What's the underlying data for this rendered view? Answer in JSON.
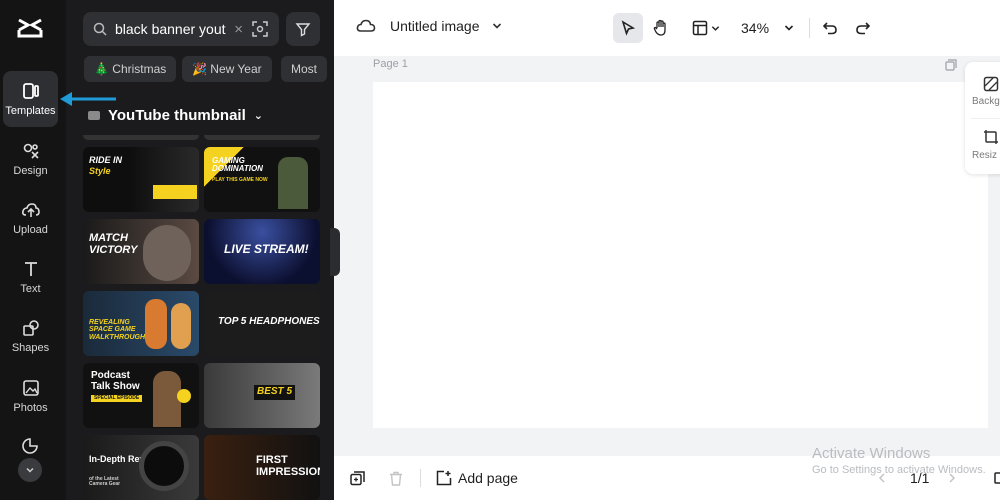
{
  "rail": {
    "items": [
      {
        "label": "Templates",
        "icon": "templates-icon"
      },
      {
        "label": "Design",
        "icon": "design-icon"
      },
      {
        "label": "Upload",
        "icon": "upload-icon"
      },
      {
        "label": "Text",
        "icon": "text-icon"
      },
      {
        "label": "Shapes",
        "icon": "shapes-icon"
      },
      {
        "label": "Photos",
        "icon": "photos-icon"
      }
    ]
  },
  "search": {
    "value": "black banner yout",
    "clear": "×"
  },
  "chips": [
    "🎄 Christmas",
    "🎉 New Year",
    "Most"
  ],
  "category": {
    "label": "YouTube thumbnail",
    "chevron": "⌄"
  },
  "templates": [
    {
      "title": "RIDE IN",
      "subtitle": "Style"
    },
    {
      "title": "GAMING DOMINATION",
      "subtitle": "PLAY THIS GAME NOW"
    },
    {
      "title": "MATCH VICTORY",
      "subtitle": ""
    },
    {
      "title": "LIVE STREAM!",
      "subtitle": ""
    },
    {
      "title": "REVEALING SPACE GAME WALKTHROUGH",
      "subtitle": ""
    },
    {
      "title": "TOP 5 HEADPHONES",
      "subtitle": ""
    },
    {
      "title": "Podcast Talk Show",
      "subtitle": "SPECIAL EPISODE"
    },
    {
      "title": "BEST 5",
      "subtitle": ""
    },
    {
      "title": "In-Depth Review",
      "subtitle": "of the Latest Camera Gear"
    },
    {
      "title": "FIRST IMPRESSION",
      "subtitle": ""
    }
  ],
  "topbar": {
    "title": "Untitled image",
    "zoom": "34%"
  },
  "canvas": {
    "page_label": "Page 1"
  },
  "side": {
    "background": "Backg",
    "resize": "Resiz"
  },
  "bottombar": {
    "add_page": "Add page",
    "pager": "1/1"
  },
  "watermark": {
    "line1": "Activate Windows",
    "line2": "Go to Settings to activate Windows."
  },
  "colors": {
    "rail_bg": "#141414",
    "panel_bg": "#1b1b1d",
    "accent_arrow": "#1f9bd7",
    "yellow": "#f4d21f"
  }
}
